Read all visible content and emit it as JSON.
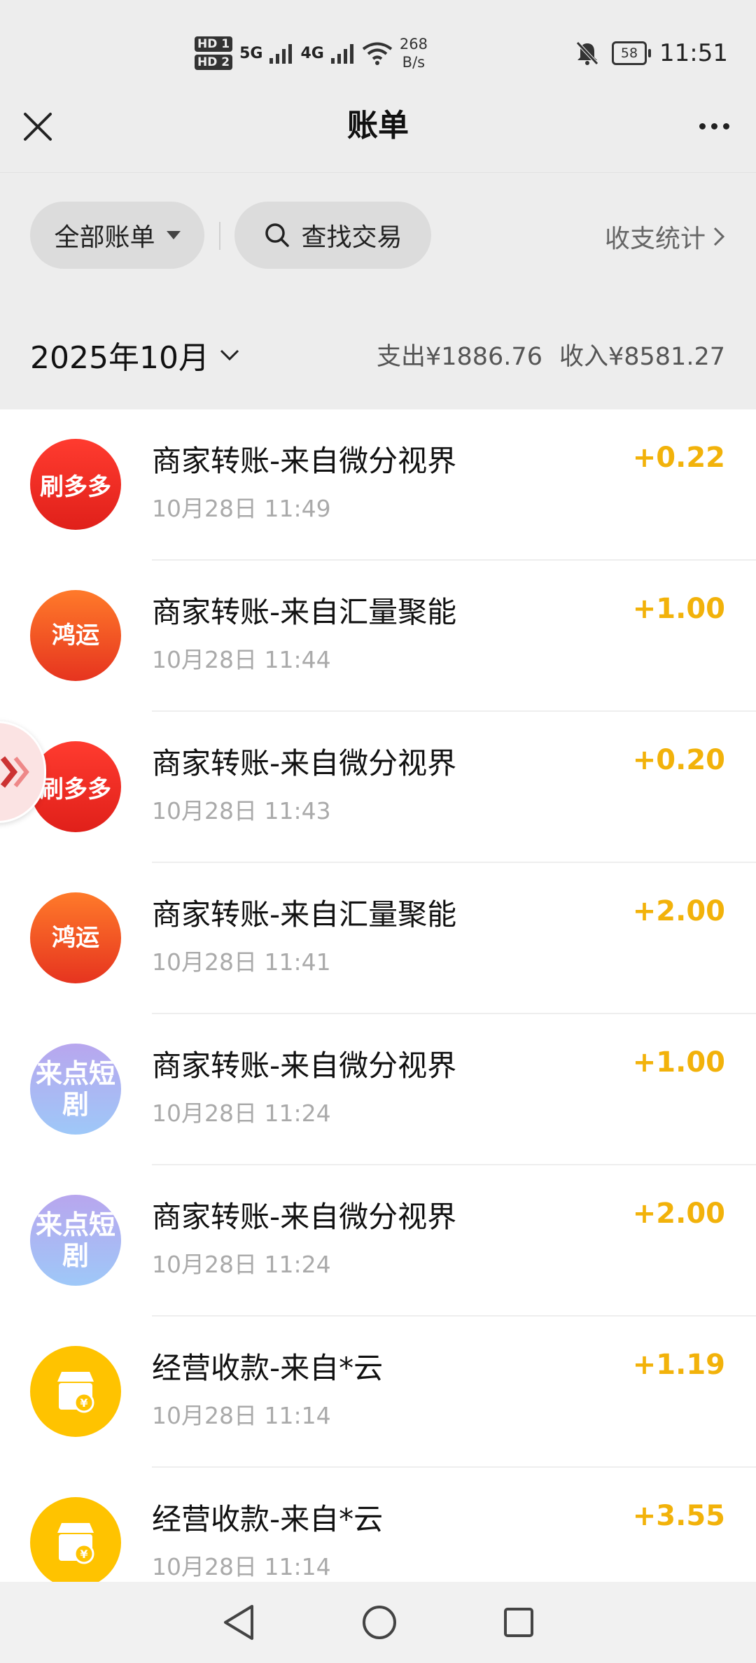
{
  "status_bar": {
    "network_1": "HD 1",
    "network_2": "HD 2",
    "signal_1": "5G",
    "signal_2": "4G",
    "speed_value": "268",
    "speed_unit": "B/s",
    "battery": "58",
    "time": "11:51"
  },
  "header": {
    "title": "账单",
    "close_icon": "close-icon",
    "more_icon": "more-icon"
  },
  "filters": {
    "all_bills": "全部账单",
    "search": "查找交易",
    "stats": "收支统计"
  },
  "month": {
    "label": "2025年10月",
    "expense": "支出¥1886.76",
    "income": "收入¥8581.27"
  },
  "colors": {
    "amount": "#f2b20a",
    "background": "#ededed"
  },
  "transactions": [
    {
      "avatar_text": "刷多多",
      "name": "商家转账-来自微分视界",
      "date": "10月28日 11:49",
      "amount": "+0.22"
    },
    {
      "avatar_text": "鸿运",
      "name": "商家转账-来自汇量聚能",
      "date": "10月28日 11:44",
      "amount": "+1.00"
    },
    {
      "avatar_text": "刷多多",
      "name": "商家转账-来自微分视界",
      "date": "10月28日 11:43",
      "amount": "+0.20"
    },
    {
      "avatar_text": "鸿运",
      "name": "商家转账-来自汇量聚能",
      "date": "10月28日 11:41",
      "amount": "+2.00"
    },
    {
      "avatar_text": "来点短剧",
      "name": "商家转账-来自微分视界",
      "date": "10月28日 11:24",
      "amount": "+1.00"
    },
    {
      "avatar_text": "来点短剧",
      "name": "商家转账-来自微分视界",
      "date": "10月28日 11:24",
      "amount": "+2.00"
    },
    {
      "avatar_text": "",
      "name": "经营收款-来自*云",
      "date": "10月28日 11:14",
      "amount": "+1.19"
    },
    {
      "avatar_text": "",
      "name": "经营收款-来自*云",
      "date": "10月28日 11:14",
      "amount": "+3.55"
    }
  ],
  "nav": {
    "back_icon": "back-icon",
    "home_icon": "home-icon",
    "recents_icon": "recents-icon"
  }
}
